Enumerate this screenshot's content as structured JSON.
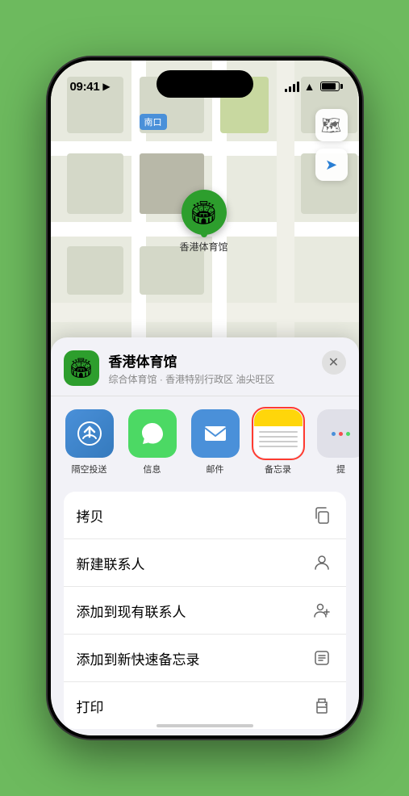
{
  "status_bar": {
    "time": "09:41",
    "location_arrow": "▶"
  },
  "map": {
    "label_tag": "南口",
    "venue_pin_label": "香港体育馆"
  },
  "controls": {
    "map_type_icon": "🗺",
    "location_icon": "➤"
  },
  "sheet": {
    "venue_name": "香港体育馆",
    "venue_sub": "综合体育馆 · 香港特别行政区 油尖旺区",
    "close_icon": "✕"
  },
  "share_items": [
    {
      "id": "airdrop",
      "label": "隔空投送"
    },
    {
      "id": "messages",
      "label": "信息"
    },
    {
      "id": "mail",
      "label": "邮件"
    },
    {
      "id": "notes",
      "label": "备忘录",
      "selected": true
    },
    {
      "id": "more",
      "label": "提"
    }
  ],
  "actions": [
    {
      "id": "copy",
      "label": "拷贝",
      "icon": "copy"
    },
    {
      "id": "new-contact",
      "label": "新建联系人",
      "icon": "person"
    },
    {
      "id": "add-existing",
      "label": "添加到现有联系人",
      "icon": "person-add"
    },
    {
      "id": "quick-note",
      "label": "添加到新快速备忘录",
      "icon": "note"
    },
    {
      "id": "print",
      "label": "打印",
      "icon": "print"
    }
  ]
}
